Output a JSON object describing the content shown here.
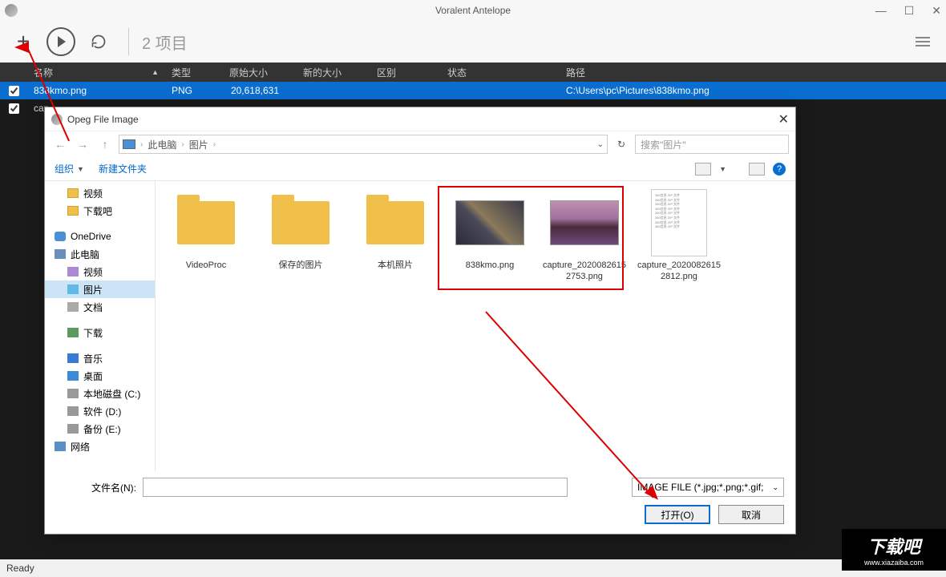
{
  "app": {
    "title": "Voralent Antelope",
    "item_count": "2 项目",
    "status": "Ready"
  },
  "columns": {
    "name": "名称",
    "type": "类型",
    "osize": "原始大小",
    "nsize": "新的大小",
    "diff": "区别",
    "status": "状态",
    "path": "路径"
  },
  "rows": [
    {
      "name": "838kmo.png",
      "type": "PNG",
      "osize": "20,618,631",
      "nsize": "",
      "diff": "",
      "status": "",
      "path": "C:\\Users\\pc\\Pictures\\838kmo.png",
      "selected": true
    },
    {
      "name": "cap",
      "type": "",
      "osize": "",
      "nsize": "",
      "diff": "",
      "status": "",
      "path": "",
      "selected": false
    }
  ],
  "dialog": {
    "title": "Opeg File Image",
    "breadcrumb": {
      "root": "此电脑",
      "folder": "图片"
    },
    "search_placeholder": "搜索\"图片\"",
    "organize": "组织",
    "new_folder": "新建文件夹",
    "filename_label": "文件名(N):",
    "filename_value": "",
    "filter": "IMAGE FILE (*.jpg;*.png;*.gif;",
    "open": "打开(O)",
    "cancel": "取消"
  },
  "tree": [
    {
      "label": "视频",
      "icon": "ic-fold",
      "indent": true
    },
    {
      "label": "下载吧",
      "icon": "ic-fold",
      "indent": true
    },
    {
      "label": "OneDrive",
      "icon": "ic-onedrive",
      "indent": false
    },
    {
      "label": "此电脑",
      "icon": "ic-pc",
      "indent": false
    },
    {
      "label": "视频",
      "icon": "ic-vid",
      "indent": true
    },
    {
      "label": "图片",
      "icon": "ic-img",
      "indent": true,
      "selected": true
    },
    {
      "label": "文档",
      "icon": "ic-doc",
      "indent": true
    },
    {
      "label": "下载",
      "icon": "ic-dl",
      "indent": true
    },
    {
      "label": "音乐",
      "icon": "ic-music",
      "indent": true
    },
    {
      "label": "桌面",
      "icon": "ic-desk",
      "indent": true
    },
    {
      "label": "本地磁盘 (C:)",
      "icon": "ic-disk",
      "indent": true
    },
    {
      "label": "软件 (D:)",
      "icon": "ic-disk",
      "indent": true
    },
    {
      "label": "备份 (E:)",
      "icon": "ic-disk",
      "indent": true
    },
    {
      "label": "网络",
      "icon": "ic-net",
      "indent": false
    }
  ],
  "files": [
    {
      "name": "VideoProc",
      "thumb": "folder"
    },
    {
      "name": "保存的图片",
      "thumb": "folder"
    },
    {
      "name": "本机照片",
      "thumb": "folder"
    },
    {
      "name": "838kmo.png",
      "thumb": "img-a"
    },
    {
      "name": "capture_20200826152753.png",
      "thumb": "img-b"
    },
    {
      "name": "capture_20200826152812.png",
      "thumb": "txt"
    }
  ],
  "watermark": {
    "cn": "下载吧",
    "url": "www.xiazaiba.com"
  }
}
